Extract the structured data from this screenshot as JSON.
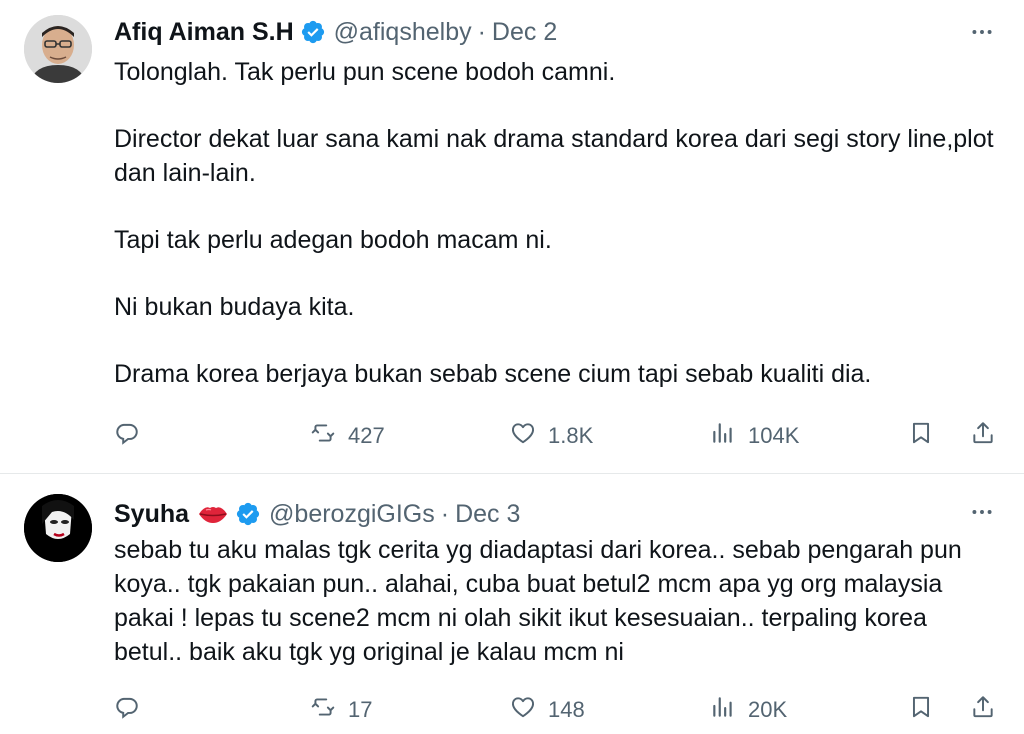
{
  "tweets": [
    {
      "name": "Afiq Aiman S.H",
      "handle": "@afiqshelby",
      "separator": "·",
      "date": "Dec 2",
      "verified": true,
      "body": [
        "Tolonglah. Tak perlu pun scene bodoh camni.",
        "",
        "Director dekat luar sana kami nak drama standard korea dari segi story line,plot dan lain-lain.",
        "",
        "Tapi tak perlu adegan bodoh macam ni.",
        "",
        "Ni bukan budaya kita.",
        "",
        "Drama korea berjaya bukan sebab scene cium tapi sebab kualiti dia."
      ],
      "stats": {
        "replies": "",
        "retweets": "427",
        "likes": "1.8K",
        "views": "104K"
      }
    },
    {
      "name": "Syuha",
      "handle": "@berozgiGIGs",
      "separator": "·",
      "date": "Dec 3",
      "verified": true,
      "name_emoji": "lips-emoji",
      "body": [
        "sebab tu aku malas tgk cerita yg diadaptasi dari korea.. sebab pengarah pun koya..  tgk pakaian pun.. alahai, cuba buat betul2 mcm apa yg org malaysia pakai !  lepas tu scene2 mcm ni olah sikit ikut kesesuaian.. terpaling korea betul.. baik aku tgk yg original je kalau mcm ni"
      ],
      "stats": {
        "replies": "",
        "retweets": "17",
        "likes": "148",
        "views": "20K"
      }
    }
  ],
  "colors": {
    "text": "#0f1419",
    "secondary": "#536471",
    "verified": "#1d9bf0",
    "divider": "#e6e9ea"
  },
  "icons": [
    "reply-icon",
    "retweet-icon",
    "like-icon",
    "views-icon",
    "bookmark-icon",
    "share-icon",
    "more-icon",
    "verified-icon"
  ]
}
